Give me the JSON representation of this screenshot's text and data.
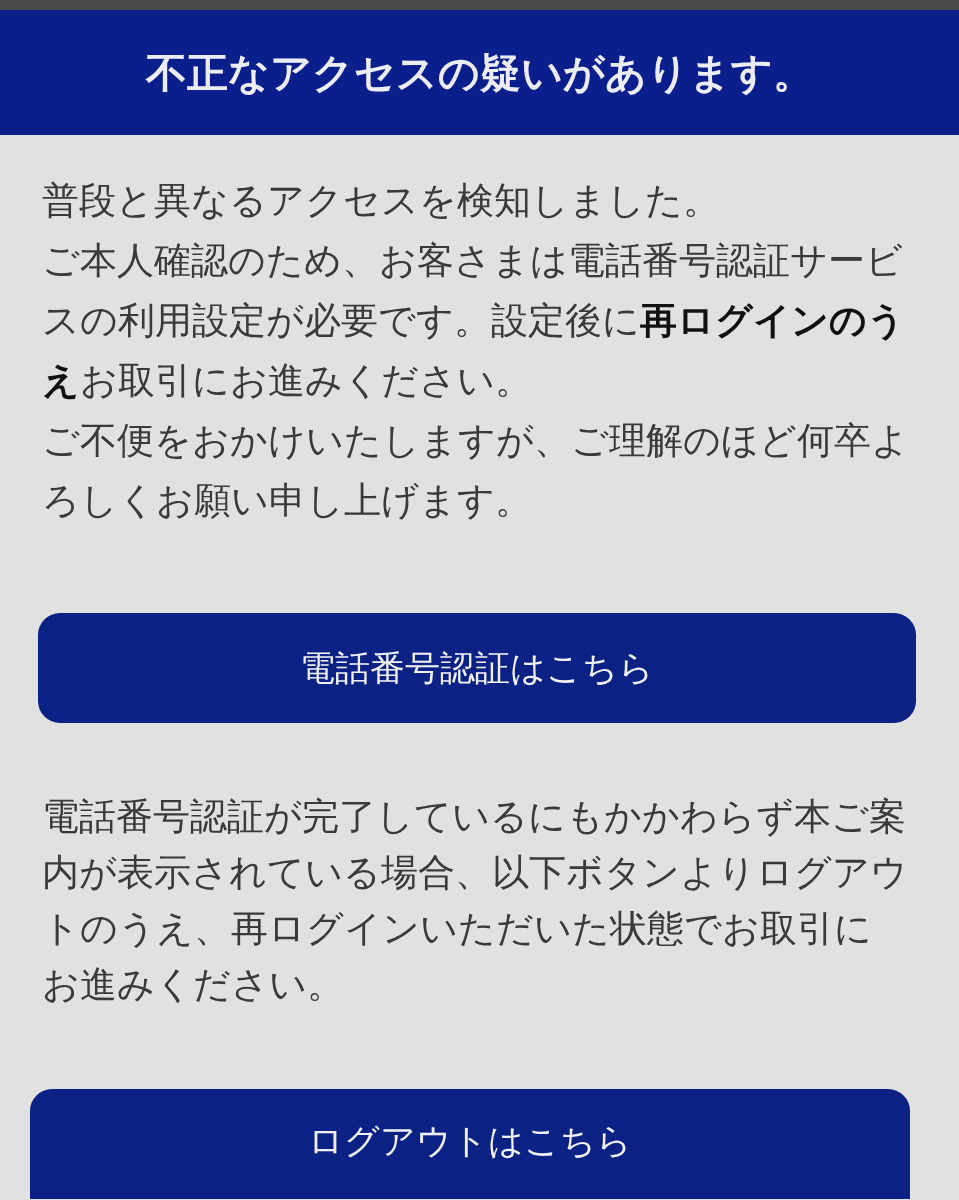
{
  "header": {
    "title": "不正なアクセスの疑いがあります。"
  },
  "sections": [
    {
      "paragraphs": [
        "普段と異なるアクセスを検知しました。",
        "ご本人確認のため、お客さまは電話番号認証サービスの利用設定が必要です。設定後に**再ログインのうえ**お取引にお進みください。",
        "ご不便をおかけいたしますが、ご理解のほど何卒よろしくお願い申し上げます。"
      ],
      "button": {
        "label": "電話番号認証はこちら"
      }
    },
    {
      "paragraphs": [
        "電話番号認証が完了しているにもかかわらず本ご案内が表示されている場合、以下ボタンよりログアウトのうえ、再ログインいただいた状態でお取引にお進みください。"
      ],
      "button": {
        "label": "ログアウトはこちら"
      }
    }
  ]
}
